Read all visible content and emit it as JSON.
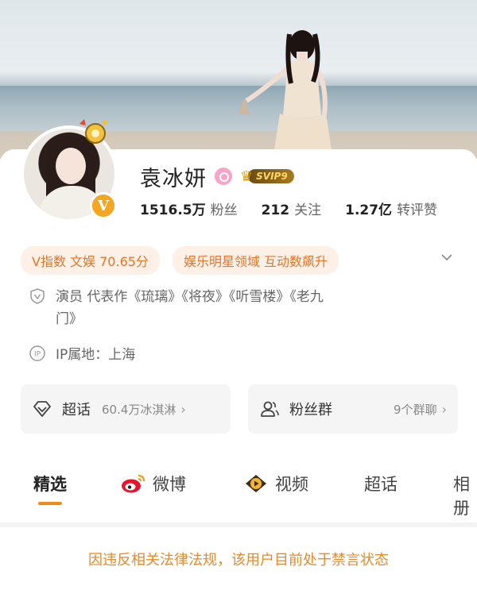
{
  "profile": {
    "name": "袁冰妍",
    "vip_label": "SVIP9",
    "verified_mark": "V"
  },
  "stats": [
    {
      "value": "1516.5万",
      "label": "粉丝"
    },
    {
      "value": "212",
      "label": "关注"
    },
    {
      "value": "1.27亿",
      "label": "转评赞"
    }
  ],
  "tags": {
    "v_index": "V指数 文娱 70.65分",
    "domain": "娱乐明星领域 互动数飙升"
  },
  "info": {
    "works_line1": "演员 代表作《琉璃》《将夜》《听雪楼》《老九",
    "works_line2": "门》",
    "ip_location": "IP属地：上海"
  },
  "cards": {
    "super_topic": {
      "title": "超话",
      "sub": "60.4万冰淇淋"
    },
    "fan_group": {
      "title": "粉丝群",
      "sub": "9个群聊"
    }
  },
  "tabs": [
    "精选",
    "微博",
    "视频",
    "超话",
    "相册"
  ],
  "notice": "因违反相关法律法规，该用户目前处于禁言状态",
  "colors": {
    "accent": "#f08a1c",
    "tag_text": "#e8752a",
    "tag_bg": "#fdf0e6",
    "notice_text": "#e8892a"
  },
  "icons": {
    "more": "chevron-down-icon",
    "works": "shield-v-icon",
    "ip": "ip-location-icon",
    "super_topic": "diamond-icon",
    "fan_group": "people-icon",
    "weibo": "weibo-logo-icon",
    "video": "video-play-icon"
  }
}
